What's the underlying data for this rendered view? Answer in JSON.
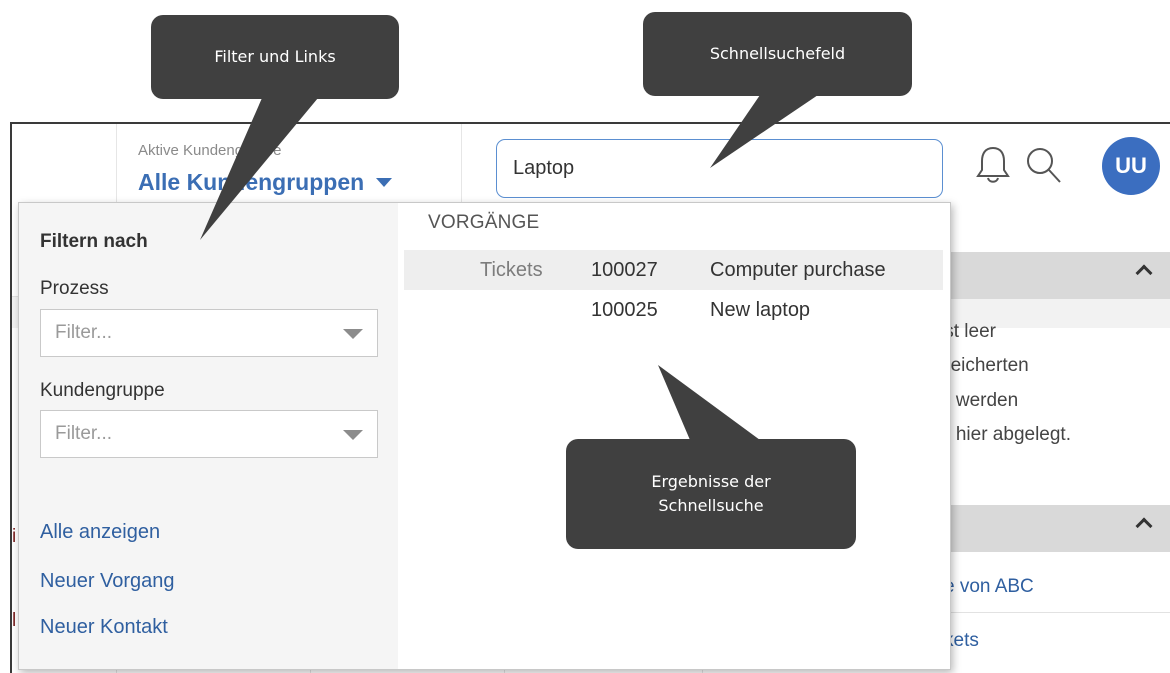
{
  "header": {
    "active_group_label": "Aktive Kundengruppe",
    "active_group_value": "Alle Kundengruppen",
    "search_value": "Laptop",
    "avatar_initials": "UU"
  },
  "filter": {
    "title": "Filtern nach",
    "process_label": "Prozess",
    "process_placeholder": "Filter...",
    "group_label": "Kundengruppe",
    "group_placeholder": "Filter...",
    "links": [
      "Alle anzeigen",
      "Neuer Vorgang",
      "Neuer Kontakt"
    ]
  },
  "results": {
    "section": "VORGÄNGE",
    "rows": [
      {
        "category": "Tickets",
        "number": "100027",
        "title": "Computer purchase"
      },
      {
        "category": "",
        "number": "100025",
        "title": "New laptop"
      }
    ]
  },
  "background": {
    "panel_text": [
      "ist leer",
      "peicherten",
      "n werden",
      "h hier abgelegt."
    ],
    "panel_links": [
      "e von ABC",
      "kets"
    ],
    "fragments": [
      "i",
      "l"
    ]
  },
  "callouts": {
    "filters": "Filter und Links",
    "search": "Schnellsuchefeld",
    "results_line1": "Ergebnisse der",
    "results_line2": "Schnellsuche"
  },
  "colors": {
    "accent": "#3b6eb4",
    "avatar": "#3b6ec0",
    "link": "#2f5fa0",
    "callout": "#404040"
  }
}
